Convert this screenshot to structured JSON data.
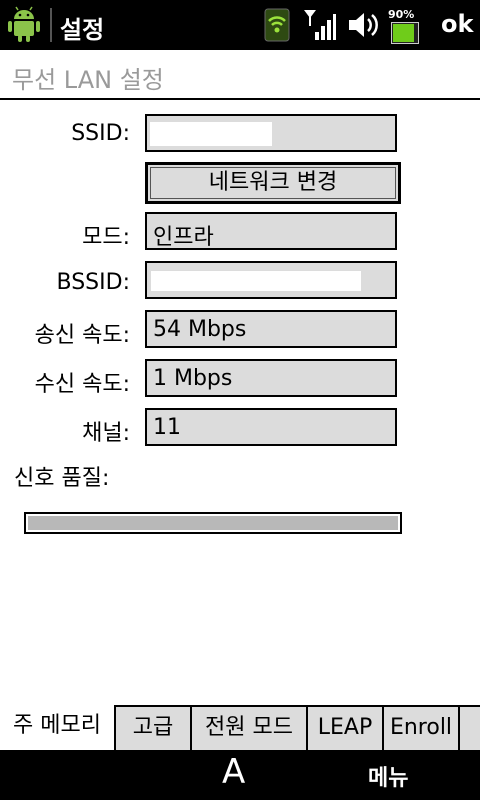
{
  "statusbar": {
    "app_title": "설정",
    "battery_percent": "90%",
    "battery_level": 0.9,
    "ok_label": "ok"
  },
  "header": {
    "title": "무선 LAN 설정"
  },
  "form": {
    "ssid_label": "SSID:",
    "ssid_value": "",
    "change_network_label": "네트워크 변경",
    "mode_label": "모드:",
    "mode_value": "인프라",
    "bssid_label": "BSSID:",
    "bssid_value": "",
    "tx_speed_label": "송신 속도:",
    "tx_speed_value": "54 Mbps",
    "rx_speed_label": "수신 속도:",
    "rx_speed_value": "1 Mbps",
    "channel_label": "채널:",
    "channel_value": "11",
    "signal_quality_label": "신호 품질:",
    "signal_quality_level": 1.0
  },
  "tabs": [
    {
      "label": "주 메모리",
      "active": true
    },
    {
      "label": "고급",
      "active": false
    },
    {
      "label": "전원 모드",
      "active": false
    },
    {
      "label": "LEAP",
      "active": false
    },
    {
      "label": "Enroll",
      "active": false
    }
  ],
  "softkeys": {
    "keyboard_label": "A",
    "menu_label": "메뉴"
  },
  "colors": {
    "battery_green": "#6fcc1a",
    "field_gray": "#dcdcdc",
    "title_gray": "#9a9a9a"
  },
  "icons": [
    "android-icon",
    "wifi-icon",
    "signal-icon",
    "volume-icon",
    "battery-icon"
  ]
}
